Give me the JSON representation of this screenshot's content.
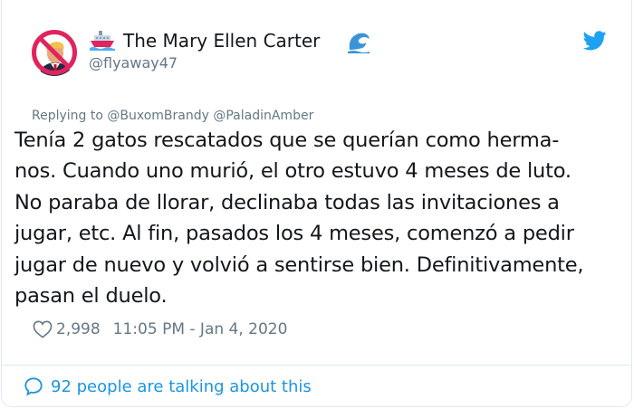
{
  "author": {
    "display_name": "The Mary Ellen Carter",
    "handle": "@flyaway47",
    "avatar_icon": "no-sign-avatar-icon",
    "name_emoji_left": "ship-icon",
    "name_emoji_right": "wave-icon"
  },
  "tweet": {
    "replying_to": "Replying to @BuxomBrandy @PaladinAmber",
    "text": "Tenía 2 gatos rescatados que se querían como herma-\nnos. Cuando uno murió, el otro estuvo 4 meses de luto.\nNo paraba de llorar, declinaba todas las invitaciones a\njugar, etc. Al fin, pasados los 4 meses, comenzó a pedir\njugar de nuevo y volvió a sentirse bien. Definitivamente,\npasan el duelo.",
    "likes": "2,998",
    "timestamp": "11:05 PM - Jan 4, 2020"
  },
  "footer": {
    "talking_text": "92 people are talking about this"
  },
  "colors": {
    "accent": "#1da1f2",
    "muted": "#657786",
    "text": "#14171a",
    "link": "#1b95e0",
    "no_sign_red": "#e0245e"
  }
}
